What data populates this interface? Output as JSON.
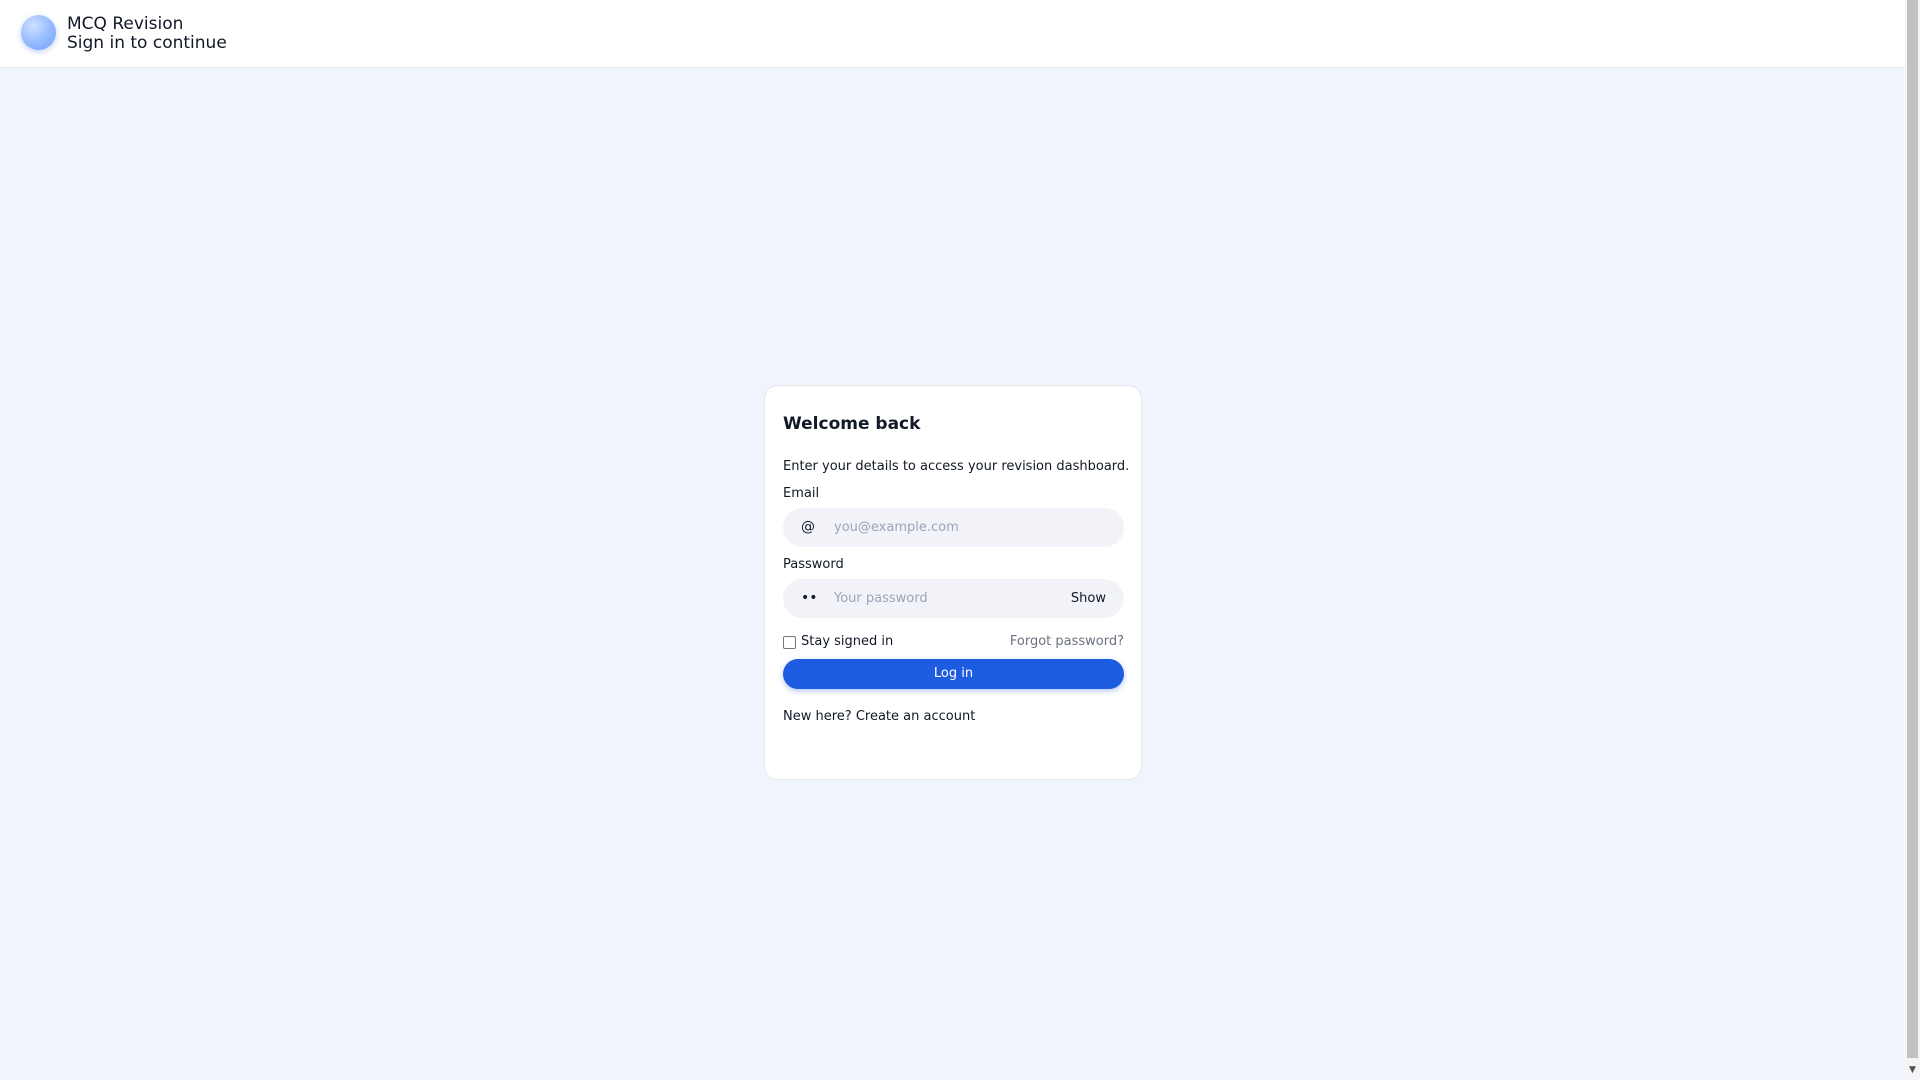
{
  "header": {
    "app_name": "MCQ Revision",
    "subtitle": "Sign in to continue"
  },
  "card": {
    "title": "Welcome back",
    "description": "Enter your details to access your revision dashboard.",
    "email": {
      "label": "Email",
      "icon": "@",
      "value": "",
      "placeholder": "you@example.com"
    },
    "password": {
      "label": "Password",
      "icon": "••",
      "value": "",
      "placeholder": "Your password",
      "show_label": "Show"
    },
    "remember_label": "Stay signed in",
    "remember_checked": false,
    "forgot_label": "Forgot password?",
    "login_label": "Log in",
    "signup_prompt": "New here?",
    "signup_link": "Create an account"
  },
  "colors": {
    "accent": "#1d5be0",
    "background": "#f0f4fd"
  }
}
